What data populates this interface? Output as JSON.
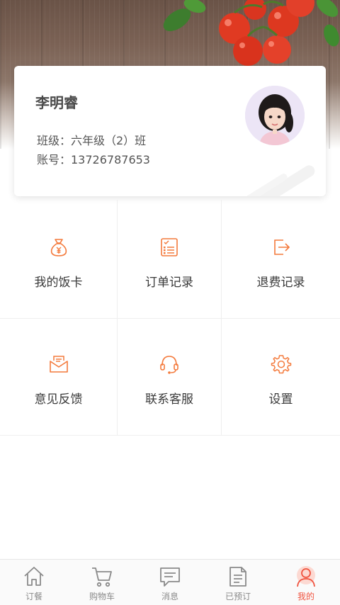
{
  "profile": {
    "name": "李明睿",
    "class_text": "班级：六年级（2）班",
    "account_text": "账号：13726787653"
  },
  "menu": {
    "items": [
      {
        "label": "我的饭卡",
        "icon": "money-bag-icon"
      },
      {
        "label": "订单记录",
        "icon": "order-list-icon"
      },
      {
        "label": "退费记录",
        "icon": "exit-refund-icon"
      },
      {
        "label": "意见反馈",
        "icon": "envelope-icon"
      },
      {
        "label": "联系客服",
        "icon": "headset-icon"
      },
      {
        "label": "设置",
        "icon": "gear-icon"
      }
    ]
  },
  "tabbar": {
    "tabs": [
      {
        "label": "订餐",
        "icon": "home-icon",
        "active": false
      },
      {
        "label": "购物车",
        "icon": "cart-icon",
        "active": false
      },
      {
        "label": "消息",
        "icon": "message-icon",
        "active": false
      },
      {
        "label": "已预订",
        "icon": "document-icon",
        "active": false
      },
      {
        "label": "我的",
        "icon": "user-icon",
        "active": true
      }
    ]
  },
  "colors": {
    "accent": "#f0533f",
    "icon_orange": "#f47a3c",
    "text_dark": "#3a3a3a",
    "tab_inactive": "#8a8a8a"
  }
}
